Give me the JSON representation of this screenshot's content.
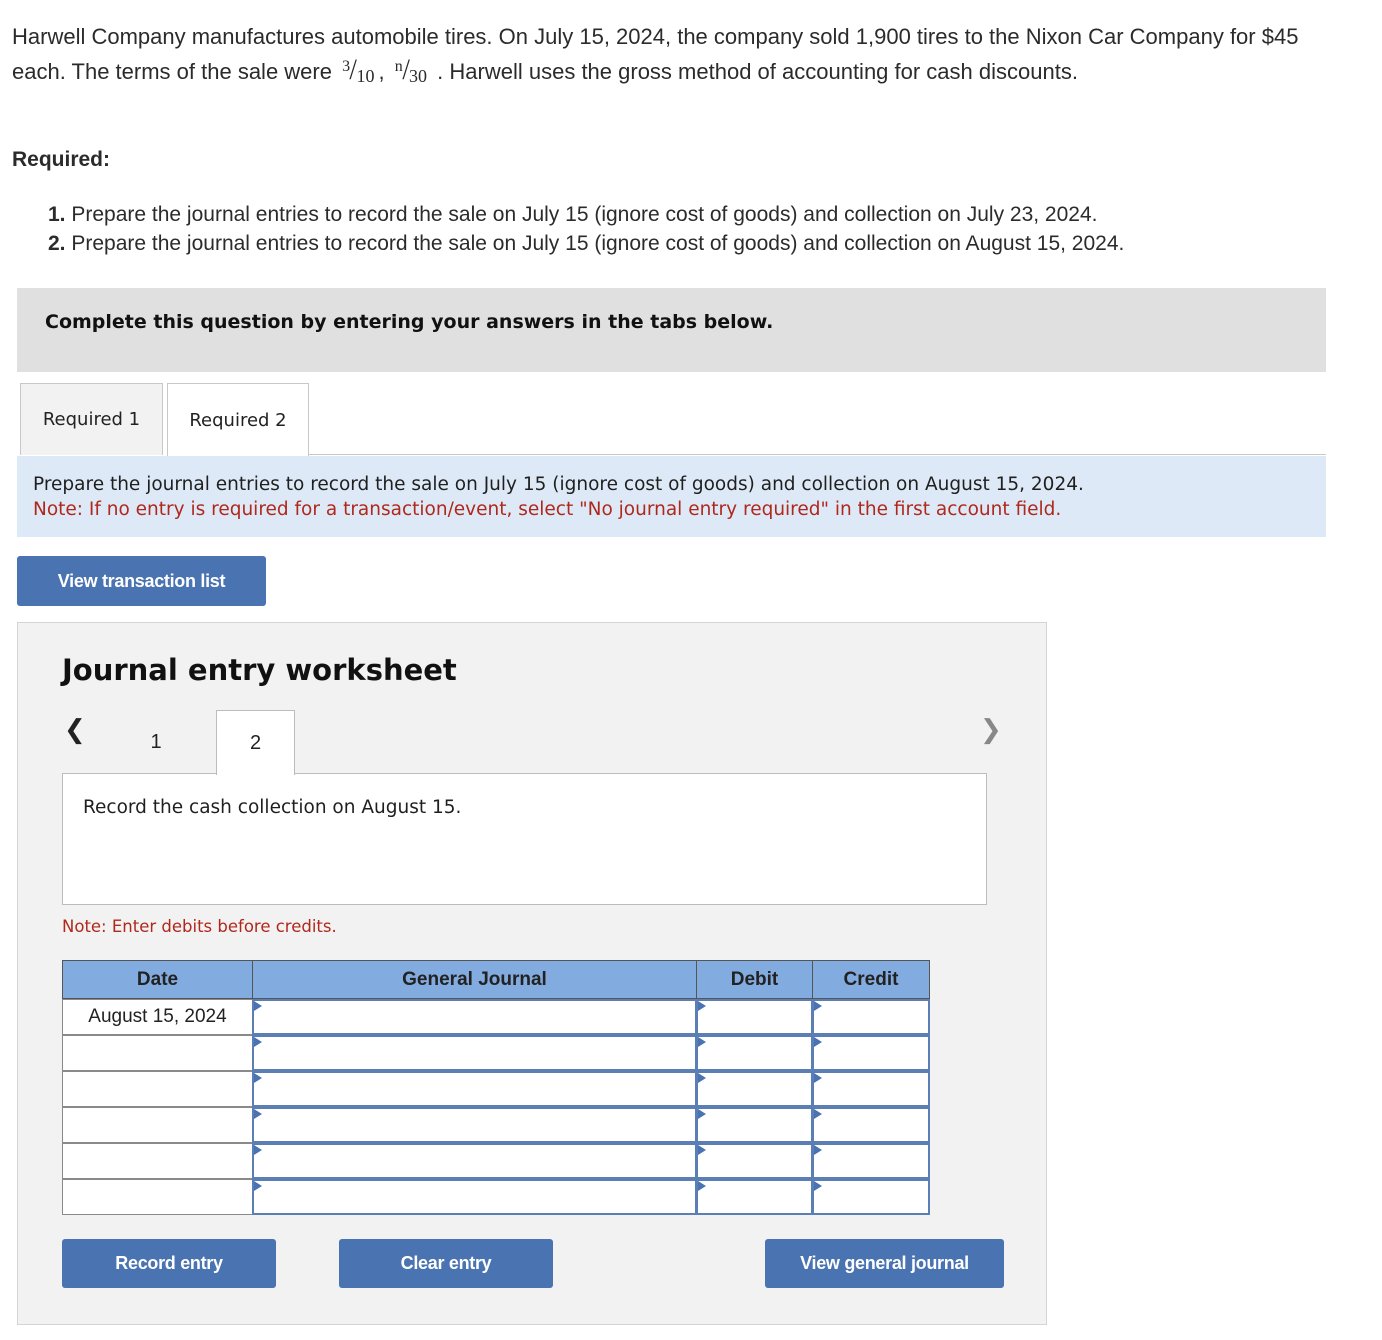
{
  "problem": {
    "text_part1": "Harwell Company manufactures automobile tires. On July 15, 2024, the company sold 1,900 tires to the Nixon Car Company for $45 each. The terms of the sale were",
    "terms": [
      {
        "numerator": "3",
        "denominator": "10"
      },
      {
        "numerator": "n",
        "denominator": "30"
      }
    ],
    "terms_separator": ",",
    "text_part2": ". Harwell uses the gross method of accounting for cash discounts."
  },
  "required": {
    "heading": "Required:",
    "items": [
      {
        "number": "1.",
        "text": "Prepare the journal entries to record the sale on July 15 (ignore cost of goods) and collection on July 23, 2024."
      },
      {
        "number": "2.",
        "text": "Prepare the journal entries to record the sale on July 15 (ignore cost of goods) and collection on August 15, 2024."
      }
    ]
  },
  "banner": {
    "text": "Complete this question by entering your answers in the tabs below."
  },
  "tabs": [
    {
      "label": "Required 1",
      "active": false
    },
    {
      "label": "Required 2",
      "active": true
    }
  ],
  "instructions": {
    "line1": "Prepare the journal entries to record the sale on July 15 (ignore cost of goods) and collection on August 15, 2024.",
    "line2": "Note: If no entry is required for a transaction/event, select \"No journal entry required\" in the first account field."
  },
  "buttons": {
    "view_transaction_list": "View transaction list",
    "record_entry": "Record entry",
    "clear_entry": "Clear entry",
    "view_general_journal": "View general journal"
  },
  "worksheet": {
    "title": "Journal entry worksheet",
    "prev_icon": "chevron-left-icon",
    "next_icon": "chevron-right-icon",
    "steps": [
      {
        "label": "1",
        "active": false
      },
      {
        "label": "2",
        "active": true
      }
    ],
    "description": "Record the cash collection on August 15.",
    "note": "Note: Enter debits before credits.",
    "table": {
      "headers": [
        "Date",
        "General Journal",
        "Debit",
        "Credit"
      ],
      "rows": [
        {
          "date": "August 15, 2024",
          "account": "",
          "debit": "",
          "credit": ""
        },
        {
          "date": "",
          "account": "",
          "debit": "",
          "credit": ""
        },
        {
          "date": "",
          "account": "",
          "debit": "",
          "credit": ""
        },
        {
          "date": "",
          "account": "",
          "debit": "",
          "credit": ""
        },
        {
          "date": "",
          "account": "",
          "debit": "",
          "credit": ""
        },
        {
          "date": "",
          "account": "",
          "debit": "",
          "credit": ""
        }
      ]
    }
  },
  "colors": {
    "button_blue": "#4a73b2",
    "table_header_blue": "#82abdf",
    "note_red": "#b0281c",
    "instruction_bg": "#dde9f6",
    "banner_bg": "#e0e0e0",
    "worksheet_bg": "#f2f2f2"
  }
}
